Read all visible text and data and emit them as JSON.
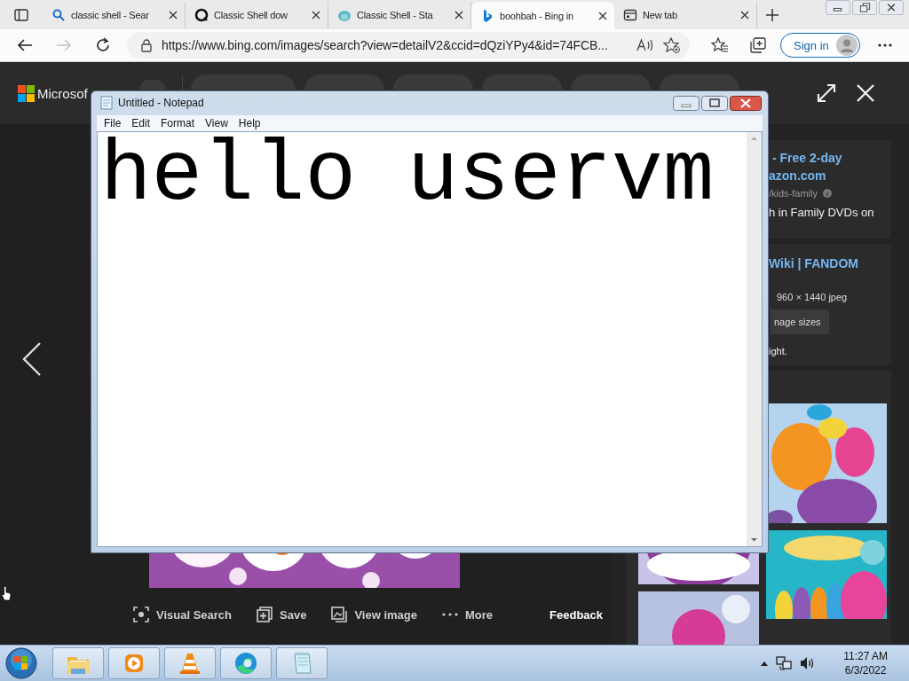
{
  "browser": {
    "tabs": [
      {
        "kind": "search",
        "title": "classic shell - Sear",
        "selected": false
      },
      {
        "kind": "ring",
        "title": "Classic Shell dow",
        "selected": false
      },
      {
        "kind": "shell",
        "title": "Classic Shell - Sta",
        "selected": false
      },
      {
        "kind": "bing",
        "title": "boohbah - Bing in",
        "selected": true
      },
      {
        "kind": "newtab",
        "title": "New tab",
        "selected": false
      }
    ],
    "forward_disabled": true,
    "url": "https://www.bing.com/images/search?view=detailV2&ccid=dQziYPy4&id=74FCB...",
    "sign_in": "Sign in"
  },
  "viewer": {
    "brand": "Microsof",
    "toolbar": [
      {
        "kind": "visual-search",
        "label": "Visual Search"
      },
      {
        "kind": "save",
        "label": "Save"
      },
      {
        "kind": "view-image",
        "label": "View image"
      },
      {
        "kind": "more",
        "label": "More"
      }
    ],
    "feedback": "Feedback",
    "cards": [
      {
        "lines": [
          {
            "kind": "link",
            "text": "- Free 2-day"
          },
          {
            "kind": "link",
            "text": "azon.com"
          },
          {
            "kind": "source",
            "text": "/kids-family"
          },
          {
            "kind": "body",
            "text": "h in Family DVDs on"
          }
        ]
      },
      {
        "lines": [
          {
            "kind": "link",
            "text": "Wiki | FANDOM"
          },
          {
            "kind": "meta",
            "text": "960 × 1440 jpeg"
          },
          {
            "kind": "button",
            "text": "nage sizes"
          },
          {
            "kind": "body",
            "text": "ight."
          }
        ]
      }
    ]
  },
  "notepad": {
    "title": "Untitled - Notepad",
    "menu": [
      "File",
      "Edit",
      "Format",
      "View",
      "Help"
    ],
    "text": "hello uservm"
  },
  "taskbar": {
    "apps": [
      {
        "kind": "folder"
      },
      {
        "kind": "player"
      },
      {
        "kind": "cone"
      },
      {
        "kind": "edge"
      },
      {
        "kind": "notepad"
      }
    ],
    "time": "11:27 AM",
    "date": "6/3/2022"
  }
}
